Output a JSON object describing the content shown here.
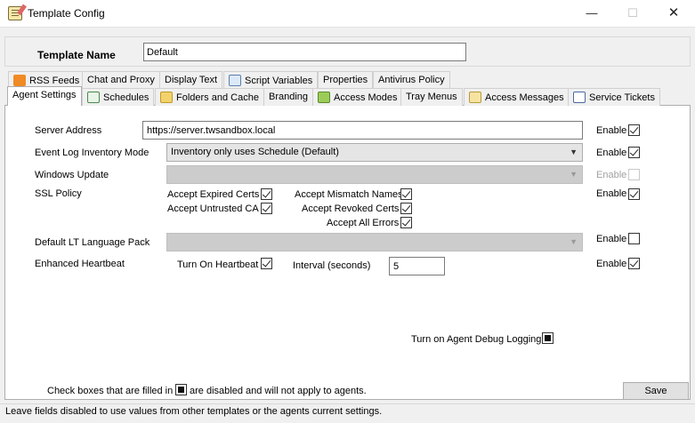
{
  "window": {
    "title": "Template Config"
  },
  "template_name": {
    "label": "Template Name",
    "value": "Default"
  },
  "tabs_row1": [
    "RSS Feeds",
    "Chat and Proxy",
    "Display Text",
    "Script Variables",
    "Properties",
    "Antivirus Policy"
  ],
  "tabs_row2": [
    "Agent Settings",
    "Schedules",
    "Folders and Cache",
    "Branding",
    "Access Modes",
    "Tray Menus",
    "Access Messages",
    "Service Tickets"
  ],
  "active_tab": "Agent Settings",
  "fields": {
    "server_address": {
      "label": "Server Address",
      "value": "https://server.twsandbox.local"
    },
    "event_log": {
      "label": "Event Log Inventory Mode",
      "value": "Inventory only uses Schedule (Default)"
    },
    "windows_update": {
      "label": "Windows Update",
      "value": ""
    },
    "ssl_policy": {
      "label": "SSL Policy",
      "options": {
        "expired": "Accept Expired Certs",
        "untrusted": "Accept Untrusted CA",
        "mismatch": "Accept Mismatch Names",
        "revoked": "Accept Revoked Certs",
        "all_errors": "Accept All Errors"
      }
    },
    "language_pack": {
      "label": "Default LT Language Pack",
      "value": ""
    },
    "heartbeat": {
      "label": "Enhanced Heartbeat",
      "turn_on_label": "Turn On Heartbeat",
      "interval_label": "Interval (seconds)",
      "interval_value": "5"
    }
  },
  "enable_label": "Enable",
  "debug_logging_label": "Turn on Agent Debug Logging",
  "footer": {
    "note_before": "Check boxes that are filled in",
    "note_after": "are disabled and will not apply to agents.",
    "save_label": "Save",
    "status": "Leave fields disabled to use values from other templates or the agents current settings."
  },
  "window_buttons": {
    "minimize": "—",
    "maximize": "☐",
    "close": "✕"
  }
}
